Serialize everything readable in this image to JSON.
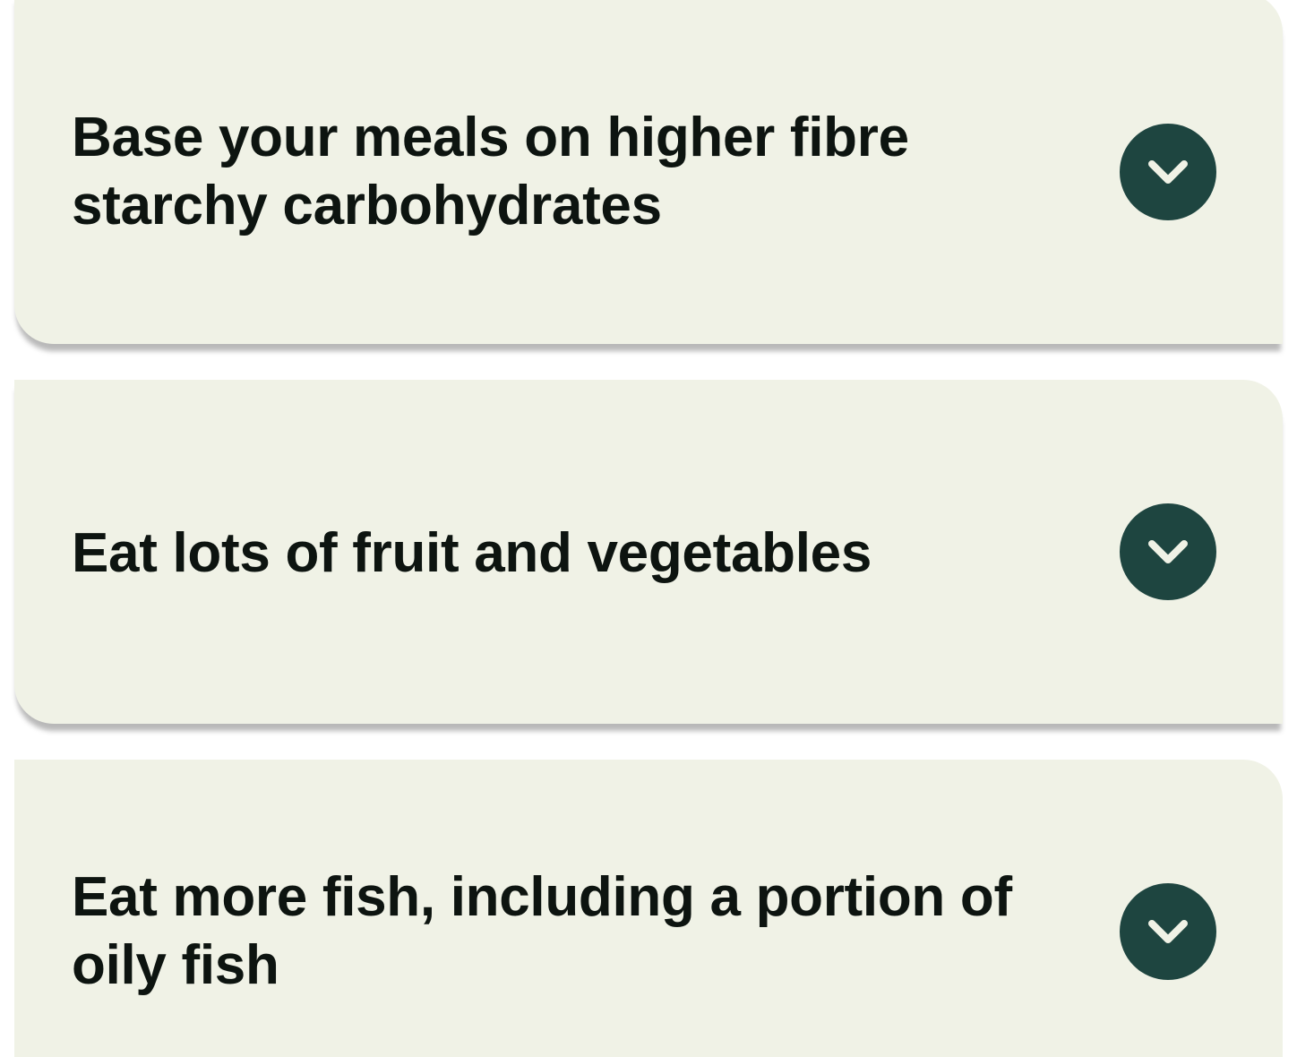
{
  "accordion": {
    "items": [
      {
        "title": "Base your meals on higher fibre starchy carbohydrates",
        "icon": "chevron-down-icon",
        "expanded": false
      },
      {
        "title": "Eat lots of fruit and vegetables",
        "icon": "chevron-down-icon",
        "expanded": false
      },
      {
        "title": "Eat more fish, including a portion of oily fish",
        "icon": "chevron-down-icon",
        "expanded": false
      }
    ]
  },
  "colors": {
    "card_background": "#f0f2e6",
    "toggle_background": "#1e4540",
    "chevron": "#f0f2e6",
    "title_text": "#0d1410"
  }
}
